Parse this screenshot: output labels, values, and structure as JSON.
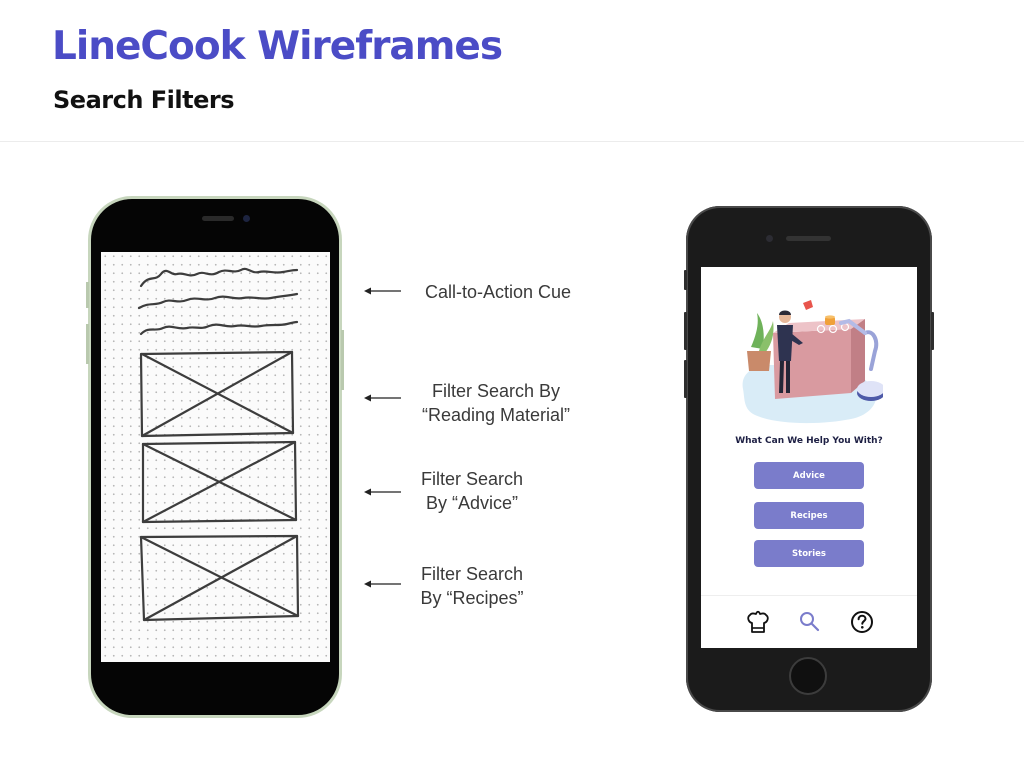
{
  "slide": {
    "title": "LineCook Wireframes",
    "subtitle": "Search Filters"
  },
  "annotations": [
    {
      "lines": [
        "Call-to-Action Cue"
      ]
    },
    {
      "lines": [
        "Filter Search By",
        "“Reading Material”"
      ]
    },
    {
      "lines": [
        "Filter Search",
        "By “Advice”"
      ]
    },
    {
      "lines": [
        "Filter Search",
        "By “Recipes”"
      ]
    }
  ],
  "app": {
    "heading": "What Can We Help You With?",
    "buttons": [
      "Advice",
      "Recipes",
      "Stories"
    ],
    "nav_icons": [
      "chef-hat-icon",
      "search-icon",
      "help-icon"
    ],
    "colors": {
      "accent": "#7a7ccb",
      "title": "#4b4cc6",
      "active_nav": "#7a7ccb"
    }
  }
}
